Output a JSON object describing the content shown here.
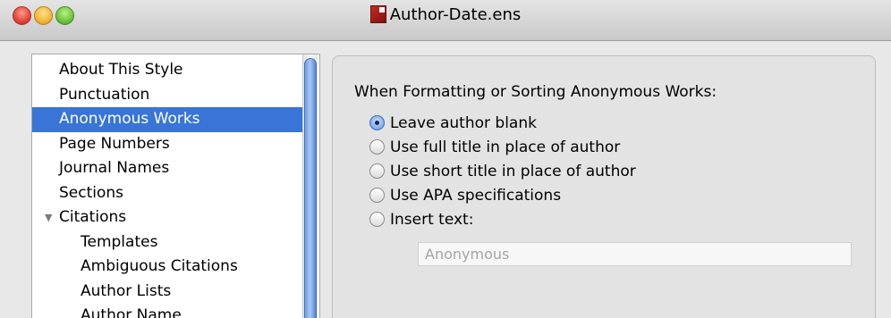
{
  "window": {
    "title": "Author-Date.ens",
    "icon": "endnote-style-file-icon",
    "controls": [
      "close",
      "minimize",
      "zoom"
    ]
  },
  "sidebar": {
    "items": [
      {
        "label": "About This Style",
        "level": 0,
        "selected": false
      },
      {
        "label": "Punctuation",
        "level": 0,
        "selected": false
      },
      {
        "label": "Anonymous Works",
        "level": 0,
        "selected": true
      },
      {
        "label": "Page Numbers",
        "level": 0,
        "selected": false
      },
      {
        "label": "Journal Names",
        "level": 0,
        "selected": false
      },
      {
        "label": "Sections",
        "level": 0,
        "selected": false
      },
      {
        "label": "Citations",
        "level": 0,
        "selected": false,
        "expanded": true
      },
      {
        "label": "Templates",
        "level": 1,
        "selected": false
      },
      {
        "label": "Ambiguous Citations",
        "level": 1,
        "selected": false
      },
      {
        "label": "Author Lists",
        "level": 1,
        "selected": false
      },
      {
        "label": "Author Name",
        "level": 1,
        "selected": false
      }
    ],
    "selection_color": "#3875d7"
  },
  "panel": {
    "heading": "When Formatting or Sorting Anonymous Works:",
    "options": [
      {
        "label": "Leave author blank",
        "checked": true
      },
      {
        "label": "Use full title in place of author",
        "checked": false
      },
      {
        "label": "Use short title in place of author",
        "checked": false
      },
      {
        "label": "Use APA specifications",
        "checked": false
      },
      {
        "label": "Insert text:",
        "checked": false
      }
    ],
    "insert_text": {
      "value": "Anonymous",
      "enabled": false
    }
  }
}
